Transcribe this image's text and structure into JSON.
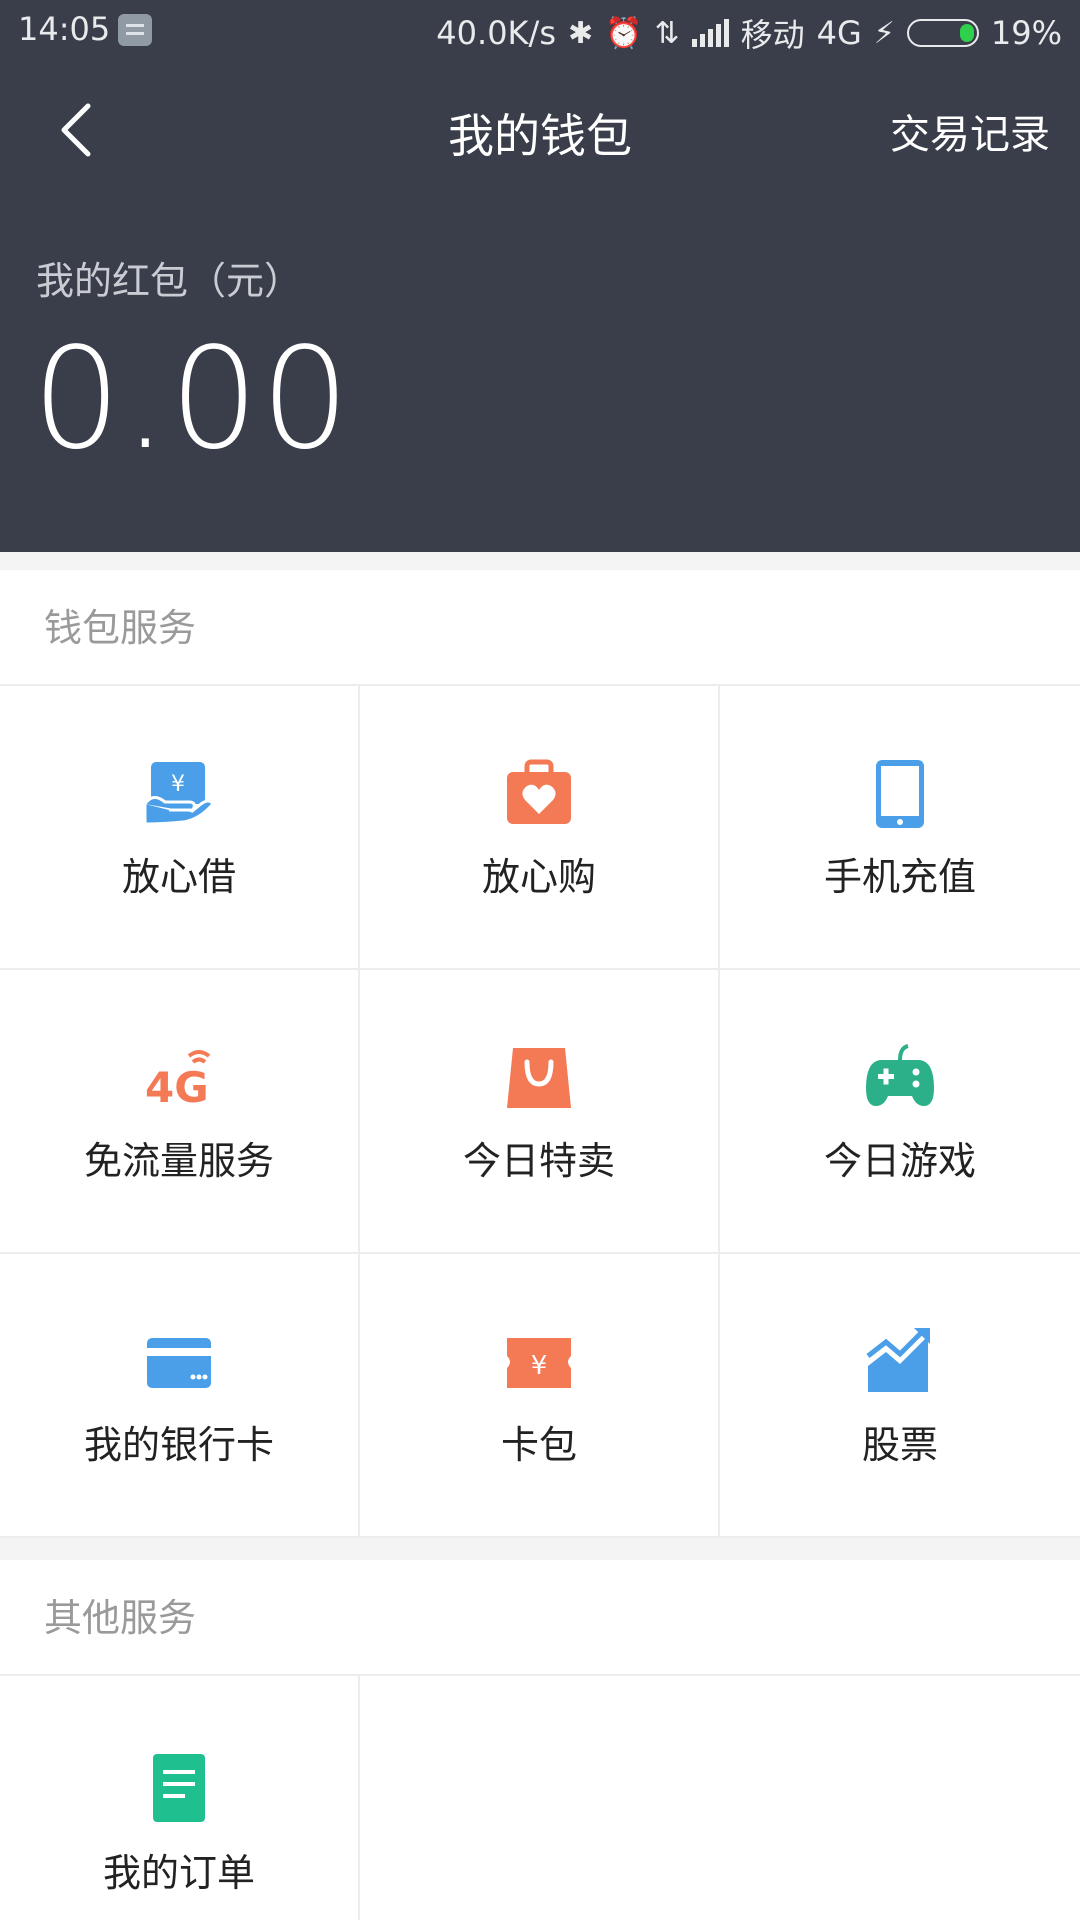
{
  "status_bar": {
    "time": "14:05",
    "speed": "40.0K/s",
    "carrier": "移动",
    "network": "4G",
    "battery": "19%"
  },
  "nav": {
    "title": "我的钱包",
    "records": "交易记录"
  },
  "balance": {
    "label": "我的红包（元）",
    "value": "0.00"
  },
  "wallet_services": {
    "title": "钱包服务",
    "items": [
      {
        "label": "放心借",
        "icon": "loan-icon",
        "color": "#4a9fe8"
      },
      {
        "label": "放心购",
        "icon": "shopping-heart-bag-icon",
        "color": "#f47a55"
      },
      {
        "label": "手机充值",
        "icon": "phone-icon",
        "color": "#4a9fe8"
      },
      {
        "label": "免流量服务",
        "icon": "4g-data-icon",
        "color": "#f47a55"
      },
      {
        "label": "今日特卖",
        "icon": "shopping-bag-icon",
        "color": "#f47a55"
      },
      {
        "label": "今日游戏",
        "icon": "gamepad-icon",
        "color": "#2bb08a"
      },
      {
        "label": "我的银行卡",
        "icon": "bank-card-icon",
        "color": "#4a9fe8"
      },
      {
        "label": "卡包",
        "icon": "coupon-icon",
        "color": "#f47a55"
      },
      {
        "label": "股票",
        "icon": "stock-chart-icon",
        "color": "#4a9fe8"
      }
    ]
  },
  "other_services": {
    "title": "其他服务",
    "items": [
      {
        "label": "我的订单",
        "icon": "order-document-icon",
        "color": "#1fbf8f"
      }
    ]
  }
}
